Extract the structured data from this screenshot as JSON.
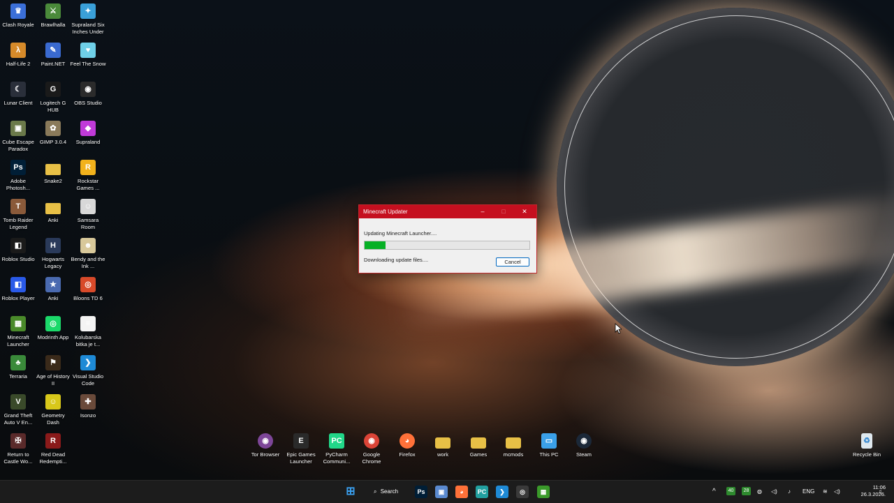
{
  "desktop_icons": [
    {
      "label": "Clash Royale",
      "icon": "clash-royale-icon",
      "color": "#3b6fd8",
      "glyph": "♛"
    },
    {
      "label": "Brawlhalla",
      "icon": "brawlhalla-icon",
      "color": "#4a8a3a",
      "glyph": "⚔"
    },
    {
      "label": "Supraland Six Inches Under",
      "icon": "supraland-siu-icon",
      "color": "#3aa0d8",
      "glyph": "✦"
    },
    {
      "label": "Half-Life 2",
      "icon": "half-life-2-icon",
      "color": "#d68a2a",
      "glyph": "λ"
    },
    {
      "label": "Paint.NET",
      "icon": "paint-net-icon",
      "color": "#3a6ad0",
      "glyph": "✎"
    },
    {
      "label": "Feel The Snow",
      "icon": "feel-the-snow-icon",
      "color": "#6fd0e8",
      "glyph": "♥"
    },
    {
      "label": "Lunar Client",
      "icon": "lunar-client-icon",
      "color": "#2a2f3a",
      "glyph": "☾"
    },
    {
      "label": "Logitech G HUB",
      "icon": "logitech-ghub-icon",
      "color": "#1a1a1a",
      "glyph": "G"
    },
    {
      "label": "OBS Studio",
      "icon": "obs-studio-icon",
      "color": "#2b2b2b",
      "glyph": "◉"
    },
    {
      "label": "Cube Escape Paradox",
      "icon": "cube-escape-icon",
      "color": "#6b7a4a",
      "glyph": "▣"
    },
    {
      "label": "GIMP 3.0.4",
      "icon": "gimp-icon",
      "color": "#8a7a5a",
      "glyph": "✿"
    },
    {
      "label": "Supraland",
      "icon": "supraland-icon",
      "color": "#c03ad8",
      "glyph": "◆"
    },
    {
      "label": "Adobe Photosh...",
      "icon": "photoshop-icon",
      "color": "#001e36",
      "glyph": "Ps"
    },
    {
      "label": "Snake2",
      "icon": "folder-icon",
      "color": "#e8c046",
      "glyph": ""
    },
    {
      "label": "Rockstar Games ...",
      "icon": "rockstar-icon",
      "color": "#f2b21c",
      "glyph": "R"
    },
    {
      "label": "Tomb Raider Legend",
      "icon": "tomb-raider-icon",
      "color": "#8a5a3a",
      "glyph": "T"
    },
    {
      "label": "Anki",
      "icon": "folder-icon",
      "color": "#e8c046",
      "glyph": ""
    },
    {
      "label": "Samsara Room",
      "icon": "samsara-room-icon",
      "color": "#d8d8d8",
      "glyph": "☺"
    },
    {
      "label": "Roblox Studio",
      "icon": "roblox-studio-icon",
      "color": "#1a1a1a",
      "glyph": "◧"
    },
    {
      "label": "Hogwarts Legacy",
      "icon": "hogwarts-legacy-icon",
      "color": "#2a3a5a",
      "glyph": "H"
    },
    {
      "label": "Bendy and the Ink ...",
      "icon": "bendy-icon",
      "color": "#d8c89a",
      "glyph": "☻"
    },
    {
      "label": "Roblox Player",
      "icon": "roblox-player-icon",
      "color": "#2a5ae8",
      "glyph": "◧"
    },
    {
      "label": "Anki",
      "icon": "anki-icon",
      "color": "#4a6ab0",
      "glyph": "★"
    },
    {
      "label": "Bloons TD 6",
      "icon": "bloons-td6-icon",
      "color": "#d84a2a",
      "glyph": "◎"
    },
    {
      "label": "Minecraft Launcher",
      "icon": "minecraft-launcher-icon",
      "color": "#4a8a2a",
      "glyph": "▦"
    },
    {
      "label": "Modrinth App",
      "icon": "modrinth-icon",
      "color": "#1bd96a",
      "glyph": "◎"
    },
    {
      "label": "Kolubarska bitka je t...",
      "icon": "text-document-icon",
      "color": "#f4f4f4",
      "glyph": "≡"
    },
    {
      "label": "Terraria",
      "icon": "terraria-icon",
      "color": "#3a8a3a",
      "glyph": "♣"
    },
    {
      "label": "Age of History II",
      "icon": "age-of-history-icon",
      "color": "#3a2a1a",
      "glyph": "⚑"
    },
    {
      "label": "Visual Studio Code",
      "icon": "vscode-icon",
      "color": "#1e8ad6",
      "glyph": "❯"
    },
    {
      "label": "Grand Theft Auto V En...",
      "icon": "gta-v-icon",
      "color": "#3a4a2a",
      "glyph": "V"
    },
    {
      "label": "Geometry Dash",
      "icon": "geometry-dash-icon",
      "color": "#d8c81a",
      "glyph": "☺"
    },
    {
      "label": "Isonzo",
      "icon": "isonzo-icon",
      "color": "#6a4a3a",
      "glyph": "✚"
    },
    {
      "label": "Return to Castle Wo...",
      "icon": "rtcw-icon",
      "color": "#5a2a2a",
      "glyph": "✠"
    },
    {
      "label": "Red Dead Redempti...",
      "icon": "rdr-icon",
      "color": "#8a1a1a",
      "glyph": "R"
    }
  ],
  "bottom_icons": [
    {
      "label": "Tor Browser",
      "icon": "tor-browser-icon",
      "color": "#7d4698",
      "glyph": "◉"
    },
    {
      "label": "Epic Games Launcher",
      "icon": "epic-games-icon",
      "color": "#2a2a2a",
      "glyph": "E"
    },
    {
      "label": "PyCharm Communi...",
      "icon": "pycharm-icon",
      "color": "#21d789",
      "glyph": "PC"
    },
    {
      "label": "Google Chrome",
      "icon": "chrome-icon",
      "color": "#db4437",
      "glyph": "◉"
    },
    {
      "label": "Firefox",
      "icon": "firefox-icon",
      "color": "#ff7139",
      "glyph": "◕"
    },
    {
      "label": "work",
      "icon": "folder-icon",
      "color": "#e8c046",
      "glyph": ""
    },
    {
      "label": "Games",
      "icon": "folder-icon",
      "color": "#e8c046",
      "glyph": ""
    },
    {
      "label": "mcmods",
      "icon": "folder-icon",
      "color": "#e8c046",
      "glyph": ""
    },
    {
      "label": "This PC",
      "icon": "this-pc-icon",
      "color": "#3aa0e8",
      "glyph": "▭"
    },
    {
      "label": "Steam",
      "icon": "steam-icon",
      "color": "#1b2838",
      "glyph": "◉"
    }
  ],
  "recycle_bin": {
    "label": "Recycle Bin",
    "icon": "recycle-bin-icon"
  },
  "dialog": {
    "title": "Minecraft Updater",
    "status_top": "Updating Minecraft Launcher....",
    "status_bottom": "Downloading update files....",
    "progress": 0.125,
    "cancel_label": "Cancel",
    "titlebar_color": "#c50f1f",
    "progress_color": "#06b025"
  },
  "taskbar": {
    "search_label": "Search",
    "apps": [
      {
        "name": "start-button",
        "glyph": "⊞",
        "color": "#3aa0f0"
      },
      {
        "name": "taskbar-photoshop",
        "glyph": "Ps",
        "color": "#001e36"
      },
      {
        "name": "taskbar-save",
        "glyph": "▣",
        "color": "#5a8ad0"
      },
      {
        "name": "taskbar-firefox",
        "glyph": "◕",
        "color": "#ff7139"
      },
      {
        "name": "taskbar-pycharm",
        "glyph": "PC",
        "color": "#21a0a0"
      },
      {
        "name": "taskbar-vscode",
        "glyph": "❯",
        "color": "#1e8ad6"
      },
      {
        "name": "taskbar-obs",
        "glyph": "◎",
        "color": "#3a3a3a"
      },
      {
        "name": "taskbar-minecraft",
        "glyph": "▦",
        "color": "#3a9a2a"
      }
    ],
    "tray": {
      "chevron": "^",
      "badge_a": "40",
      "badge_b": "28",
      "language": "ENG",
      "time": "11:06",
      "date": "26.3.2026."
    }
  }
}
